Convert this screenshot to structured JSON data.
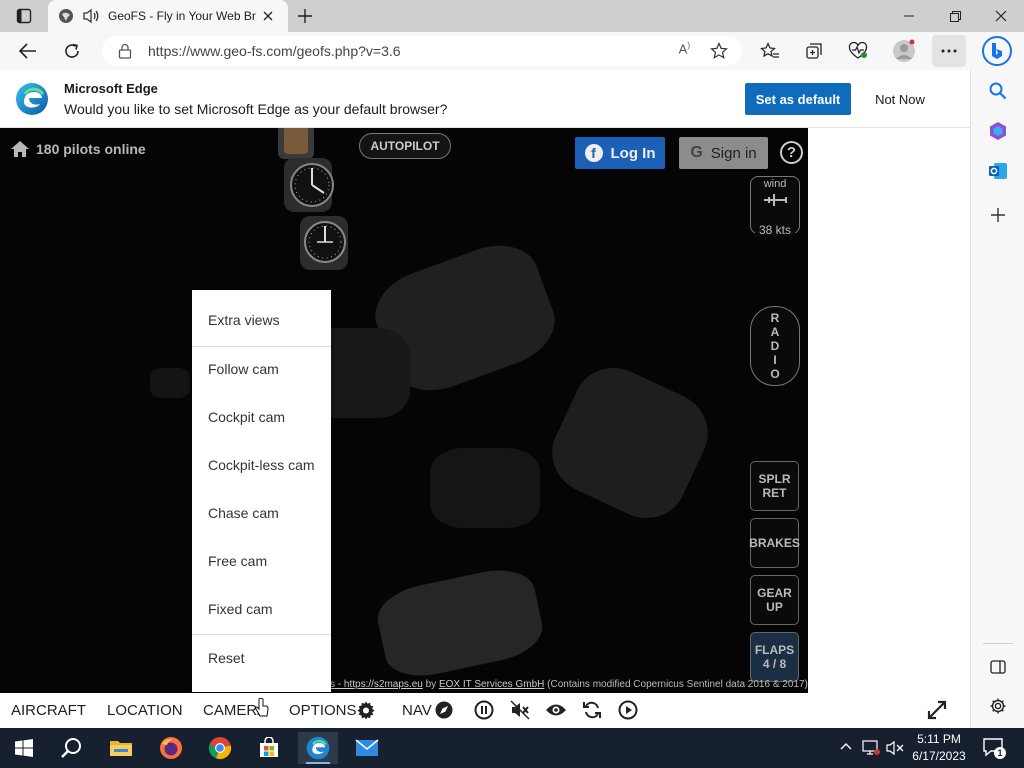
{
  "browser": {
    "tab_title": "GeoFS - Fly in Your Web Browser",
    "url": "https://www.geo-fs.com/geofs.php?v=3.6"
  },
  "banner": {
    "title": "Microsoft Edge",
    "text": "Would you like to set Microsoft Edge as your default browser?",
    "primary_label": "Set as default",
    "secondary_label": "Not Now"
  },
  "game": {
    "pilots_online": "180 pilots online",
    "autopilot_label": "AUTOPILOT",
    "login_label": "Log In",
    "signin_label": "Sign in",
    "help_label": "?",
    "wind_label": "wind",
    "wind_speed": "38 kts",
    "radio_letters": [
      "R",
      "A",
      "D",
      "I",
      "O"
    ],
    "spoilers_label": "SPLR\nRET",
    "brakes_label": "BRAKES",
    "gear_label": "GEAR\nUP",
    "flaps_label": "FLAPS\n4 / 8",
    "attribution_prefix": "s - ",
    "attribution_link1": "https://s2maps.eu",
    "attribution_by": " by ",
    "attribution_link2": "EOX IT Services GmbH",
    "attribution_suffix": " (Contains modified Copernicus Sentinel data 2016 & 2017)"
  },
  "camera_menu": {
    "items": [
      "Extra views",
      "Follow cam",
      "Cockpit cam",
      "Cockpit-less cam",
      "Chase cam",
      "Free cam",
      "Fixed cam",
      "Reset"
    ]
  },
  "bottom_bar": {
    "aircraft": "AIRCRAFT",
    "location": "LOCATION",
    "camera": "CAMERA",
    "options": "OPTIONS",
    "nav": "NAV"
  },
  "taskbar": {
    "time": "5:11 PM",
    "date": "6/17/2023",
    "notification_count": "1"
  },
  "colors": {
    "edge_blue": "#0f6cbd",
    "taskbar": "#16202e",
    "facebook": "#1c5fb7"
  }
}
